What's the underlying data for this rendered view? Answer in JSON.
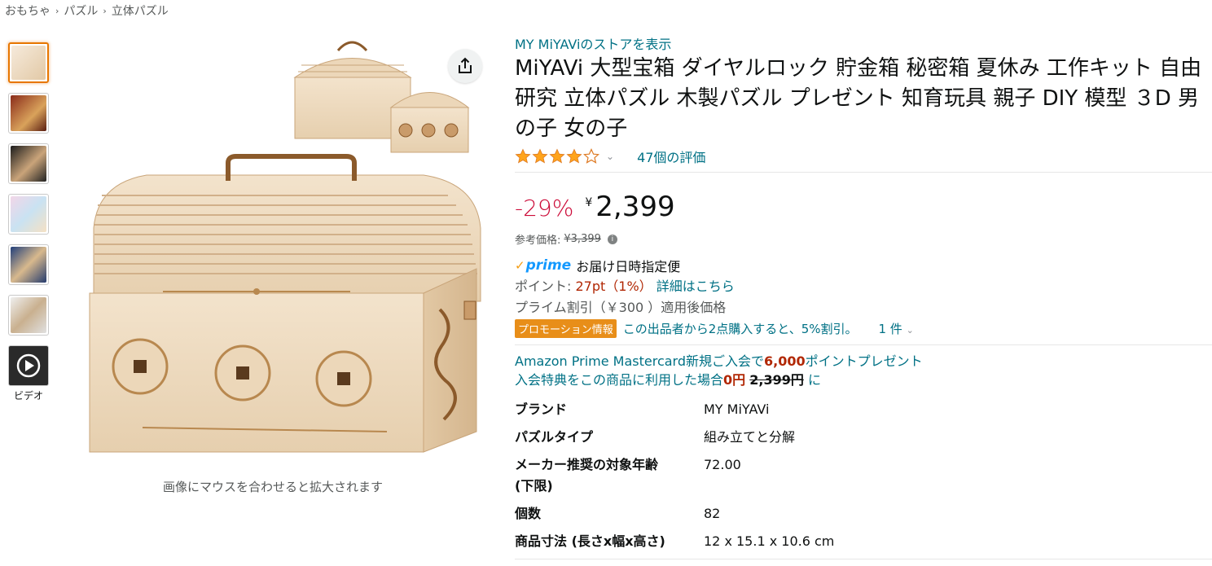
{
  "breadcrumb": [
    "おもちゃ",
    "パズル",
    "立体パズル"
  ],
  "breadcrumb_sep": "›",
  "thumbnails": {
    "video_label": "ビデオ"
  },
  "main_image": {
    "zoom_hint": "画像にマウスを合わせると拡大されます"
  },
  "product": {
    "store_link": "MY MiYAViのストアを表示",
    "title": "MiYAVi 大型宝箱 ダイヤルロック 貯金箱 秘密箱 夏休み 工作キット 自由研究 立体パズル 木製パズル プレゼント 知育玩具 親子 DIY 模型 ３D 男の子 女の子",
    "rating": 4,
    "rating_count": "47個の評価",
    "discount": "-29%",
    "currency": "¥",
    "price": "2,399",
    "ref_price_label": "参考価格:",
    "ref_price": "¥3,399",
    "prime_label": "prime",
    "delivery": "お届け日時指定便",
    "points_label": "ポイント:",
    "points_value": "27pt（1%）",
    "points_link": "詳細はこちら",
    "prime_discount": "プライム割引（￥300 ）適用後価格",
    "promo_badge": "プロモーション情報",
    "promo_text": "この出品者から2点購入すると、5%割引。",
    "promo_count": "1 件",
    "mc_line1_pre": "Amazon Prime Mastercard新規ご入会で",
    "mc_line1_bold": "6,000",
    "mc_line1_post": "ポイントプレゼント",
    "mc_line2_pre": "入会特典をこの商品に利用した場合",
    "mc_line2_bold": "0円",
    "mc_line2_strike": "2,399円",
    "mc_line2_post": "に"
  },
  "specs": [
    {
      "key": "ブランド",
      "value": "MY MiYAVi"
    },
    {
      "key": "パズルタイプ",
      "value": "組み立てと分解"
    },
    {
      "key": "メーカー推奨の対象年齢 (下限)",
      "value": "72.00"
    },
    {
      "key": "個数",
      "value": "82"
    },
    {
      "key": "商品寸法 (長さx幅x高さ)",
      "value": "12 x 15.1 x 10.6 cm"
    }
  ],
  "colors": {
    "link": "#007185",
    "discount": "#cc0c39",
    "star": "#ffa41c",
    "promo": "#e88e19",
    "prime": "#1399ff"
  }
}
